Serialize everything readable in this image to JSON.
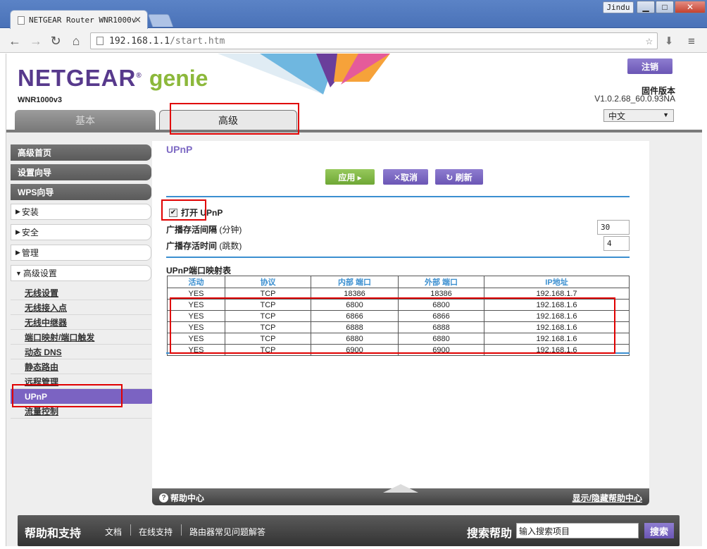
{
  "browser": {
    "tab_title": "NETGEAR Router WNR1000v",
    "user": "Jindu",
    "url_host": "192.168.1.1",
    "url_path": "/start.htm",
    "icons": [
      "back-icon",
      "forward-icon",
      "reload-icon",
      "home-icon",
      "star-icon",
      "extension-icon",
      "menu-icon"
    ]
  },
  "header": {
    "logo_brand": "NETGEAR",
    "logo_genie": "genie",
    "model": "WNR1000v3",
    "logout_label": "注销",
    "firmware_label": "固件版本",
    "firmware_version": "V1.0.2.68_60.0.93NA",
    "language": "中文",
    "tab_basic": "基本",
    "tab_advanced": "高级",
    "brand_color": "#57398c",
    "genie_color": "#8cb83b"
  },
  "sidebar": {
    "top_items": [
      "高级首页",
      "设置向导",
      "WPS向导"
    ],
    "sections": [
      "安装",
      "安全",
      "管理",
      "高级设置"
    ],
    "sub_items": [
      "无线设置",
      "无线接入点",
      "无线中继器",
      "端口映射/端口触发",
      "动态 DNS",
      "静态路由",
      "远程管理",
      "UPnP",
      "流量控制"
    ],
    "active_sub": "UPnP"
  },
  "content": {
    "title": "UPnP",
    "apply_label": "应用 ▸",
    "cancel_label": "✕取消",
    "refresh_label": "↻ 刷新",
    "enable_label": "打开 UPnP",
    "enable_checked": true,
    "adv_interval_label": "广播存活间隔",
    "adv_interval_unit": "(分钟)",
    "adv_interval_value": "30",
    "adv_ttl_label": "广播存活时间",
    "adv_ttl_unit": "(跳数)",
    "adv_ttl_value": "4",
    "table_title": "UPnP端口映射表",
    "table_headers": [
      "活动",
      "协议",
      "内部 端口",
      "外部 端口",
      "IP地址"
    ],
    "table_rows": [
      [
        "YES",
        "TCP",
        "18386",
        "18386",
        "192.168.1.7"
      ],
      [
        "YES",
        "TCP",
        "6800",
        "6800",
        "192.168.1.6"
      ],
      [
        "YES",
        "TCP",
        "6866",
        "6866",
        "192.168.1.6"
      ],
      [
        "YES",
        "TCP",
        "6888",
        "6888",
        "192.168.1.6"
      ],
      [
        "YES",
        "TCP",
        "6880",
        "6880",
        "192.168.1.6"
      ],
      [
        "YES",
        "TCP",
        "6900",
        "6900",
        "192.168.1.6"
      ]
    ]
  },
  "help_bar": {
    "help_center": "帮助中心",
    "toggle_label": "显示/隐藏帮助中心"
  },
  "footer": {
    "title": "帮助和支持",
    "links": [
      "文档",
      "在线支持",
      "路由器常见问题解答"
    ],
    "search_label": "搜索帮助",
    "search_placeholder": "输入搜索项目",
    "search_button": "搜索"
  }
}
